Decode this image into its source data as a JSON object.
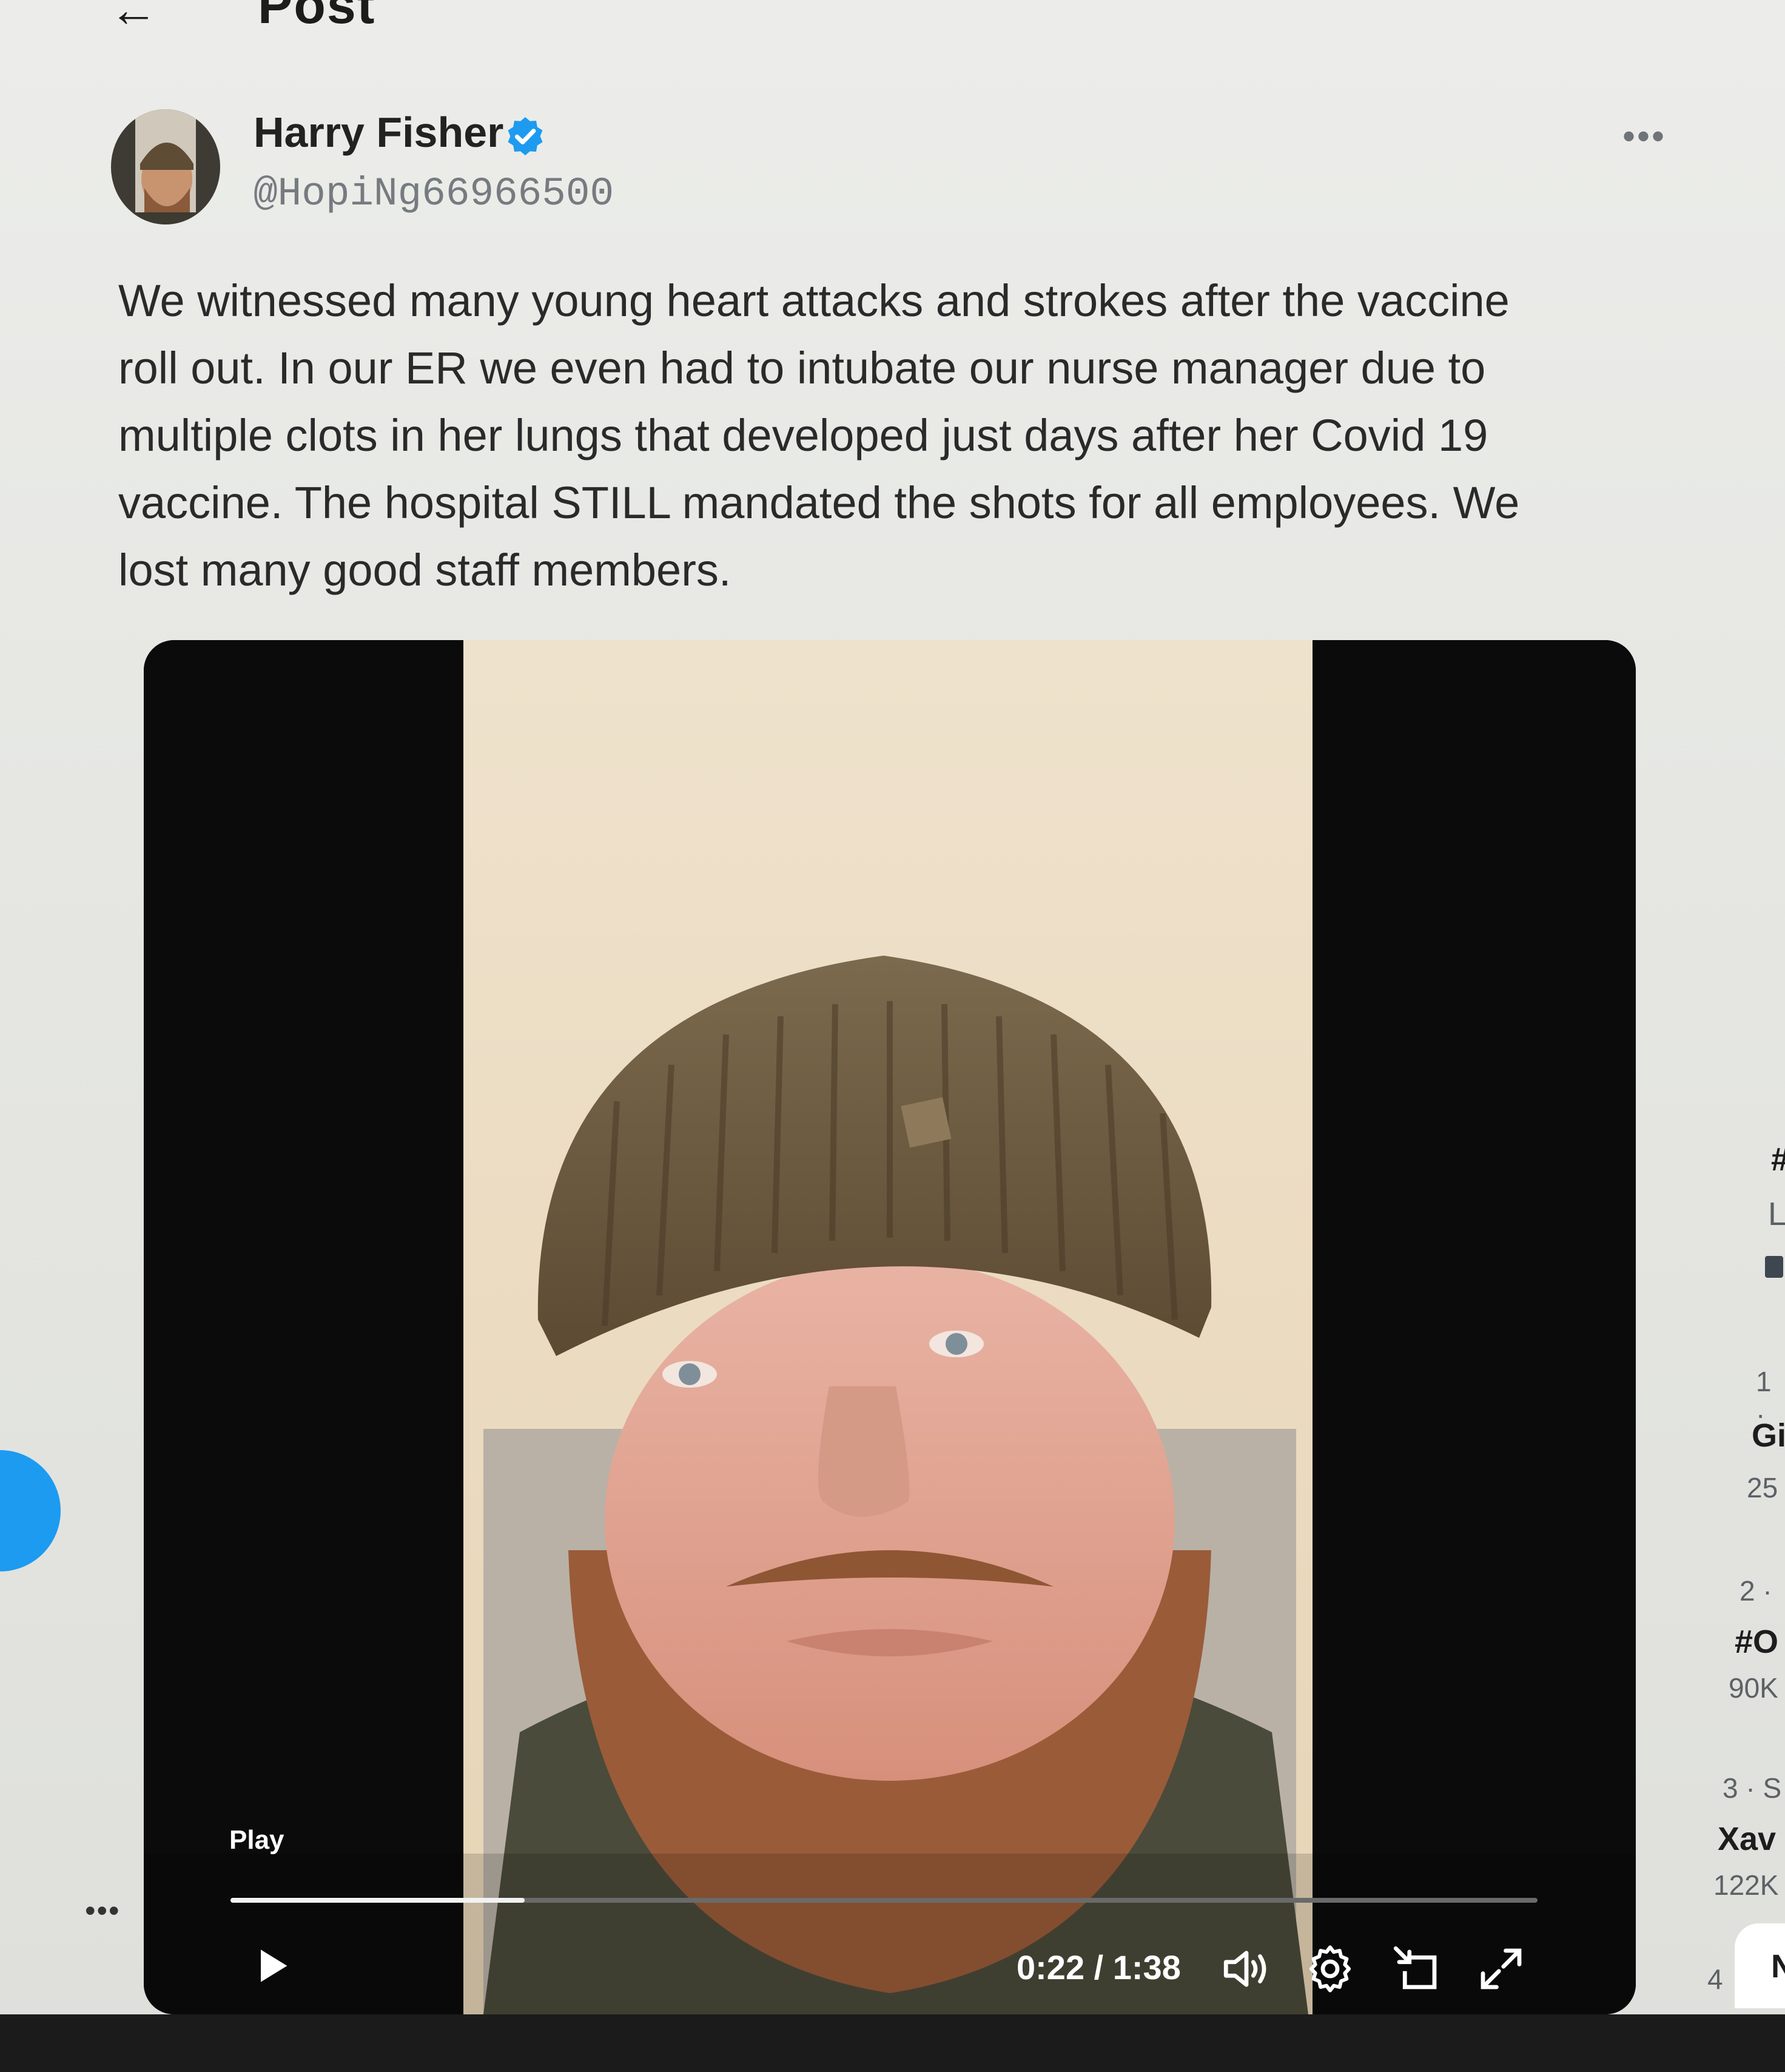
{
  "header": {
    "title": "Post"
  },
  "post": {
    "author_name": "Harry Fisher",
    "author_handle": "@HopiNg66966500",
    "text_lines": [
      "We witnessed many young heart attacks and strokes after the vaccine",
      "roll out. In our ER we even had to intubate our nurse manager due to",
      "multiple clots in her lungs that developed just days after her Covid 19",
      "vaccine. The hospital STILL mandated the shots for all employees. We",
      "lost many good staff members."
    ]
  },
  "video": {
    "play_label": "Play",
    "time": "0:22 / 1:38",
    "progress_fraction": 0.225
  },
  "sidebar": {
    "trends": [
      {
        "rank": "1 ·",
        "name": "Gi",
        "count": "25"
      },
      {
        "rank": "2 ·",
        "name": "#O",
        "count": "90K"
      },
      {
        "rank": "3 · S",
        "name": "Xav",
        "count": "122K"
      },
      {
        "rank": "4",
        "name": "N"
      }
    ],
    "partial_top": [
      "#",
      "L"
    ]
  },
  "colors": {
    "verified_blue": "#1d9bf0",
    "fab_blue": "#1d9bf0"
  }
}
